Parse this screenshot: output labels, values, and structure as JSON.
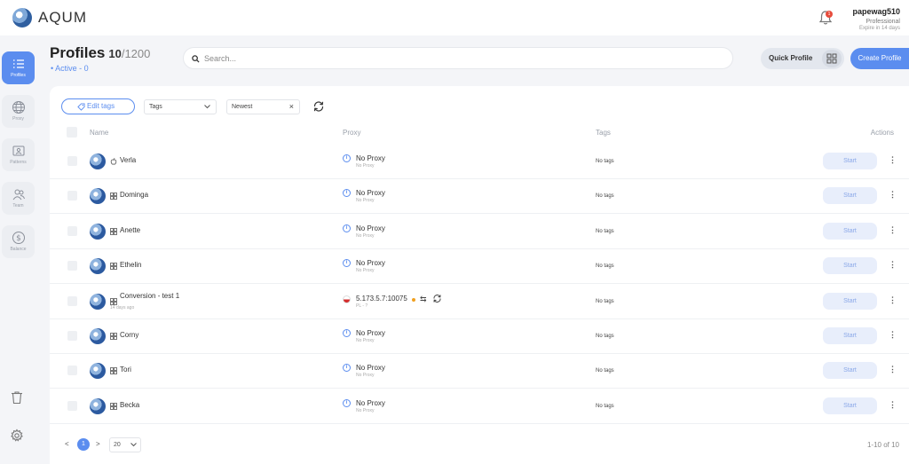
{
  "app": {
    "name": "AQUM"
  },
  "user": {
    "name": "papewag510",
    "plan": "Professional",
    "expire": "Expire in 14 days",
    "notifications": "1"
  },
  "sidebar": {
    "items": [
      {
        "label": "Profiles",
        "icon": "list-icon",
        "active": true
      },
      {
        "label": "Proxy",
        "icon": "globe-icon",
        "active": false
      },
      {
        "label": "Patterns",
        "icon": "id-card-icon",
        "active": false
      },
      {
        "label": "Team",
        "icon": "people-icon",
        "active": false
      },
      {
        "label": "Balance",
        "icon": "dollar-icon",
        "active": false
      }
    ]
  },
  "header": {
    "title": "Profiles",
    "count": "10",
    "total": "/1200",
    "active_status": "Active - 0",
    "search_placeholder": "Search...",
    "quick_profile": "Quick Profile",
    "create_profile": "Create Profile"
  },
  "filters": {
    "edit_tags": "Edit tags",
    "tags_placeholder": "Tags",
    "sort": "Newest"
  },
  "table": {
    "columns": {
      "name": "Name",
      "proxy": "Proxy",
      "tags": "Tags",
      "actions": "Actions"
    },
    "start_label": "Start",
    "rows": [
      {
        "name": "Verla",
        "os": "apple",
        "sub": "",
        "proxy": "No Proxy",
        "proxy_sub": "No Proxy",
        "tags": "No tags"
      },
      {
        "name": "Dominga",
        "os": "windows",
        "sub": "",
        "proxy": "No Proxy",
        "proxy_sub": "No Proxy",
        "tags": "No tags"
      },
      {
        "name": "Anette",
        "os": "windows",
        "sub": "",
        "proxy": "No Proxy",
        "proxy_sub": "No Proxy",
        "tags": "No tags"
      },
      {
        "name": "Ethelin",
        "os": "windows",
        "sub": "",
        "proxy": "No Proxy",
        "proxy_sub": "No Proxy",
        "tags": "No tags"
      },
      {
        "name": "Conversion - test 1",
        "os": "windows",
        "sub": "14 days ago",
        "proxy": "5.173.5.7:10075",
        "proxy_sub": "PL - ?",
        "tags": "No tags",
        "flag": "PL"
      },
      {
        "name": "Corny",
        "os": "windows",
        "sub": "",
        "proxy": "No Proxy",
        "proxy_sub": "No Proxy",
        "tags": "No tags"
      },
      {
        "name": "Tori",
        "os": "windows",
        "sub": "",
        "proxy": "No Proxy",
        "proxy_sub": "No Proxy",
        "tags": "No tags"
      },
      {
        "name": "Becka",
        "os": "windows",
        "sub": "",
        "proxy": "No Proxy",
        "proxy_sub": "No Proxy",
        "tags": "No tags"
      }
    ]
  },
  "pagination": {
    "current": "1",
    "page_size": "20",
    "range": "1-10 of 10",
    "prev": "<",
    "next": ">"
  },
  "colors": {
    "accent": "#5b8def",
    "background": "#f4f5f8",
    "panel": "#ffffff"
  }
}
